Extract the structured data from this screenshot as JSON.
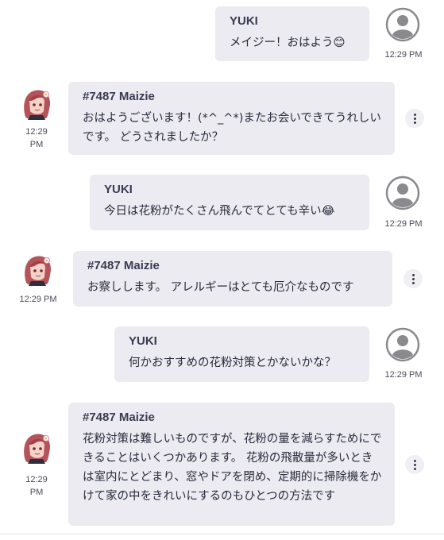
{
  "messages": [
    {
      "sender": "YUKI",
      "text": "メイジー！おはよう",
      "emoji": "😊",
      "time": "12:29 PM"
    },
    {
      "sender": "#7487 Maizie",
      "text": "おはようございます！(*^_^*)またお会いできてうれしいです。 どうされましたか？",
      "time_a": "12:29",
      "time_b": "PM"
    },
    {
      "sender": "YUKI",
      "text": "今日は花粉がたくさん飛んでてとても辛い",
      "emoji": "😂",
      "time": "12:29 PM"
    },
    {
      "sender": "#7487 Maizie",
      "text": "お察しします。 アレルギーはとても厄介なものです",
      "time": "12:29 PM"
    },
    {
      "sender": "YUKI",
      "text": "何かおすすめの花粉対策とかないかな？",
      "time": "12:29 PM"
    },
    {
      "sender": "#7487 Maizie",
      "text": "花粉対策は難しいものですが、花粉の量を減らすためにできることはいくつかあります。 花粉の飛散量が多いときは室内にとどまり、窓やドアを閉め、定期的に掃除機をかけて家の中をきれいにするのもひとつの方法です",
      "time_a": "12:29",
      "time_b": "PM"
    }
  ],
  "icons": {
    "user_avatar": "user-circle-icon",
    "bot_avatar": "character-avatar",
    "menu": "more-vertical-icon"
  }
}
